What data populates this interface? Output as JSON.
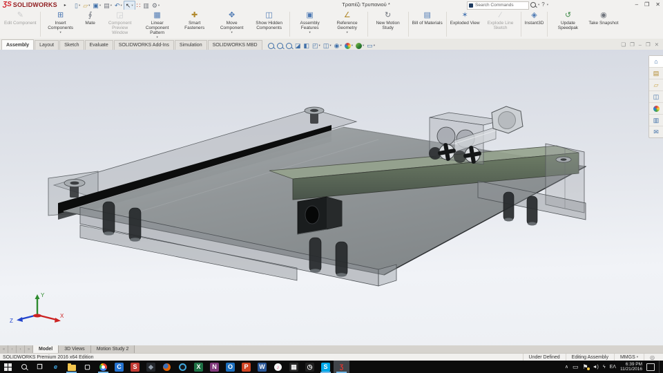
{
  "titlebar": {
    "brand_mark": "ƷS",
    "brand": "SOLIDWORKS",
    "flyout_arrow": "▸",
    "document_title": "Τραπέζι Τρυπανιού *",
    "search": {
      "placeholder": "Search Commands",
      "scope_caret": "▾",
      "help": "?"
    },
    "window_controls": {
      "minimize": "–",
      "restore": "❐",
      "close": "✕"
    },
    "quick_access": [
      {
        "name": "new",
        "glyph": "▯",
        "color": "#5b7fa6",
        "caret": "▾"
      },
      {
        "name": "open",
        "glyph": "▱",
        "color": "#c9a44a",
        "caret": "▾"
      },
      {
        "name": "save",
        "glyph": "▣",
        "color": "#3f6fa8",
        "caret": "▾"
      },
      {
        "name": "print",
        "glyph": "▤",
        "color": "#6f747c",
        "caret": "▾"
      },
      {
        "name": "undo",
        "glyph": "↶",
        "color": "#3f6fa8",
        "caret": "▾"
      },
      {
        "name": "select",
        "glyph": "↖",
        "color": "#333333",
        "caret": "▾"
      },
      {
        "name": "rebuild",
        "glyph": "∷",
        "color": "#b03a2e"
      },
      {
        "name": "file-properties",
        "glyph": "▥",
        "color": "#6f747c"
      },
      {
        "name": "options",
        "glyph": "⚙",
        "color": "#6f747c",
        "caret": "▾"
      }
    ]
  },
  "ribbon": {
    "buttons": [
      {
        "label": "Edit Component",
        "glyph": "✎",
        "color": "#97999e",
        "disabled": true
      },
      {
        "label": "Insert Components",
        "glyph": "⊞",
        "color": "#4d79b3",
        "caret": "▾"
      },
      {
        "label": "Mate",
        "glyph": "∮",
        "color": "#6f747c"
      },
      {
        "label": "Component Preview Window",
        "glyph": "◲",
        "color": "#9aa0a8",
        "disabled": true
      },
      {
        "label": "Linear Component Pattern",
        "glyph": "▦",
        "color": "#4d79b3",
        "caret": "▾"
      },
      {
        "label": "Smart Fasteners",
        "glyph": "✚",
        "color": "#b28a2e"
      },
      {
        "label": "Move Component",
        "glyph": "✥",
        "color": "#4d79b3",
        "caret": "▾"
      },
      {
        "label": "Show Hidden Components",
        "glyph": "◫",
        "color": "#4d79b3"
      },
      {
        "label": "Assembly Features",
        "glyph": "▣",
        "color": "#4d79b3",
        "caret": "▾"
      },
      {
        "label": "Reference Geometry",
        "glyph": "∠",
        "color": "#b28a2e",
        "caret": "▾"
      },
      {
        "label": "New Motion Study",
        "glyph": "↻",
        "color": "#6f747c"
      },
      {
        "label": "Bill of Materials",
        "glyph": "▤",
        "color": "#4d79b3"
      },
      {
        "label": "Exploded View",
        "glyph": "✶",
        "color": "#4d79b3"
      },
      {
        "label": "Explode Line Sketch",
        "glyph": "∕",
        "color": "#9aa0a8",
        "disabled": true
      },
      {
        "label": "Instant3D",
        "glyph": "◈",
        "color": "#4d79b3"
      },
      {
        "label": "Update Speedpak",
        "glyph": "↺",
        "color": "#3d8a46"
      },
      {
        "label": "Take Snapshot",
        "glyph": "◉",
        "color": "#6f747c"
      }
    ]
  },
  "command_tabs": [
    {
      "label": "Assembly",
      "active": true
    },
    {
      "label": "Layout"
    },
    {
      "label": "Sketch"
    },
    {
      "label": "Evaluate"
    },
    {
      "label": "SOLIDWORKS Add-Ins"
    },
    {
      "label": "Simulation"
    },
    {
      "label": "SOLIDWORKS MBD"
    }
  ],
  "viewport": {
    "hud": [
      {
        "name": "zoom-to-fit"
      },
      {
        "name": "zoom-to-area"
      },
      {
        "name": "previous-view"
      },
      {
        "name": "section-view",
        "glyph": "◪"
      },
      {
        "name": "annotation-views",
        "glyph": "◧"
      },
      {
        "name": "view-orientation",
        "glyph": "◰",
        "caret": "▾"
      },
      {
        "name": "display-style",
        "glyph": "◫",
        "caret": "▾"
      },
      {
        "name": "hide-show-items",
        "glyph": "◉",
        "caret": "▾"
      },
      {
        "name": "edit-appearance",
        "caret": "▾"
      },
      {
        "name": "apply-scene",
        "caret": "▾"
      },
      {
        "name": "view-settings",
        "glyph": "▭",
        "caret": "▾"
      }
    ],
    "doc_controls": [
      {
        "name": "new-window",
        "glyph": "❏"
      },
      {
        "name": "cascade",
        "glyph": "❐"
      },
      {
        "name": "minimize-doc",
        "glyph": "–"
      },
      {
        "name": "restore-doc",
        "glyph": "❐"
      },
      {
        "name": "close-doc",
        "glyph": "✕"
      }
    ],
    "task_pane": [
      {
        "name": "solidworks-resources",
        "glyph": "⌂",
        "color": "#3f6fa8"
      },
      {
        "name": "design-library",
        "glyph": "▤",
        "color": "#b28a2e"
      },
      {
        "name": "file-explorer-pane",
        "glyph": "▱",
        "color": "#c9a44a"
      },
      {
        "name": "view-palette",
        "glyph": "◫",
        "color": "#3f6fa8"
      },
      {
        "name": "appearances-scenes",
        "glyph": ""
      },
      {
        "name": "custom-properties",
        "glyph": "▥",
        "color": "#3f6fa8"
      },
      {
        "name": "solidworks-forum",
        "glyph": "✉",
        "color": "#3f6fa8"
      }
    ],
    "triad": {
      "x": "X",
      "y": "Y",
      "z": "Z"
    }
  },
  "model_tabs": {
    "nav": [
      "«",
      "‹",
      "›",
      "»"
    ],
    "tabs": [
      {
        "label": "Model",
        "active": true
      },
      {
        "label": "3D Views"
      },
      {
        "label": "Motion Study 2"
      }
    ]
  },
  "statusbar": {
    "edition": "SOLIDWORKS Premium 2016 x64 Edition",
    "state": "Under Defined",
    "mode": "Editing Assembly",
    "units": "MMGS",
    "caret": "▾",
    "icon_glyph": "◎"
  },
  "taskbar": {
    "items": [
      {
        "name": "start"
      },
      {
        "name": "search"
      },
      {
        "name": "task-view",
        "letter": "❐",
        "fg": "#e8e8e8"
      },
      {
        "name": "edge",
        "letter": "e",
        "fg": "#40a6e0"
      },
      {
        "name": "file-explorer",
        "open": true
      },
      {
        "name": "store",
        "letter": "▢",
        "fg": "#f0f0f0"
      },
      {
        "name": "chrome",
        "open": true
      },
      {
        "name": "c-app",
        "letter": "C",
        "fg": "#ffffff",
        "bg": "#2573d1"
      },
      {
        "name": "red-app",
        "letter": "S",
        "fg": "#ffffff",
        "bg": "#c23b33"
      },
      {
        "name": "dark-app",
        "letter": "◆",
        "fg": "#8f9aa6",
        "bg": "#23262b"
      },
      {
        "name": "firefox"
      },
      {
        "name": "ring-app"
      },
      {
        "name": "excel",
        "letter": "X",
        "fg": "#ffffff",
        "bg": "#1e7145"
      },
      {
        "name": "onenote",
        "letter": "N",
        "fg": "#ffffff",
        "bg": "#80397b"
      },
      {
        "name": "outlook",
        "letter": "O",
        "fg": "#ffffff",
        "bg": "#1d6fbe"
      },
      {
        "name": "powerpoint",
        "letter": "P",
        "fg": "#ffffff",
        "bg": "#d04423"
      },
      {
        "name": "word",
        "letter": "W",
        "fg": "#ffffff",
        "bg": "#2b5797"
      },
      {
        "name": "itunes",
        "letter": "♪"
      },
      {
        "name": "calculator",
        "letter": "▦",
        "fg": "#eeeeee",
        "bg": "#262626"
      },
      {
        "name": "alarms",
        "letter": "◷",
        "fg": "#eeeeee",
        "bg": "#202020"
      },
      {
        "name": "skype",
        "letter": "S",
        "fg": "#ffffff",
        "bg": "#00a8e8",
        "open": true
      },
      {
        "name": "solidworks",
        "letter": "Ʒ",
        "fg": "#e5352e",
        "active": true
      }
    ],
    "tray": {
      "overflow_chevron": "∧",
      "display": "▭",
      "flag": "⚑",
      "volume": "◄)",
      "connector": "ϟ",
      "language": "EΛ",
      "time": "6:39 PM",
      "date": "11/21/2016"
    }
  }
}
